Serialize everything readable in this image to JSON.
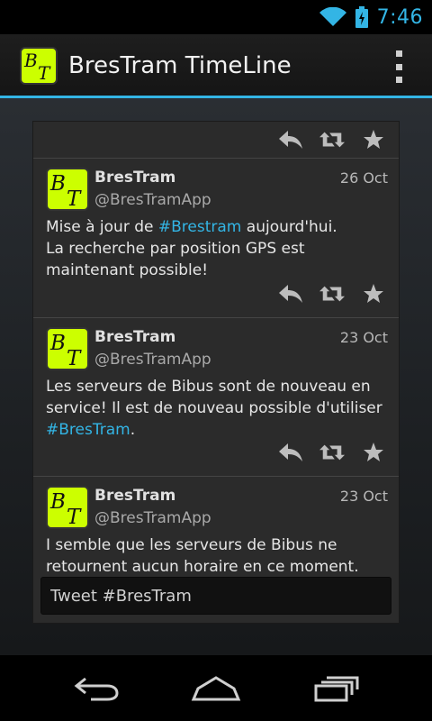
{
  "status_bar": {
    "time": "7:46",
    "icons": [
      "wifi-icon",
      "battery-charging-icon"
    ],
    "accent": "#33b5e5"
  },
  "action_bar": {
    "title": "BresTram TimeLine",
    "logo_letters": "BT",
    "menu_icon": "overflow-menu-icon"
  },
  "tweets": [
    {
      "name": "BresTram",
      "handle": "@BresTramApp",
      "date": "26 Oct",
      "line1_pre": "Mise à jour de ",
      "line1_tag": "#Brestram",
      "line1_post": " aujourd'hui.",
      "line2": "La recherche par position GPS est maintenant possible!"
    },
    {
      "name": "BresTram",
      "handle": "@BresTramApp",
      "date": "23 Oct",
      "text_pre": "Les serveurs de Bibus sont de nouveau en service! Il est de nouveau possible d'utiliser ",
      "text_tag": "#BresTram",
      "text_post": "."
    },
    {
      "name": "BresTram",
      "handle": "@BresTramApp",
      "date": "23 Oct",
      "text": "I semble que les serveurs de Bibus ne retournent aucun horaire en ce moment."
    }
  ],
  "compose": {
    "placeholder": "Tweet #BresTram"
  },
  "actions": [
    "reply-icon",
    "retweet-icon",
    "favorite-icon"
  ],
  "nav": [
    "back-icon",
    "home-icon",
    "recent-apps-icon"
  ],
  "colors": {
    "logo_bg": "#ccff00",
    "link": "#33b5e5",
    "card_bg": "#2b2b2b"
  }
}
